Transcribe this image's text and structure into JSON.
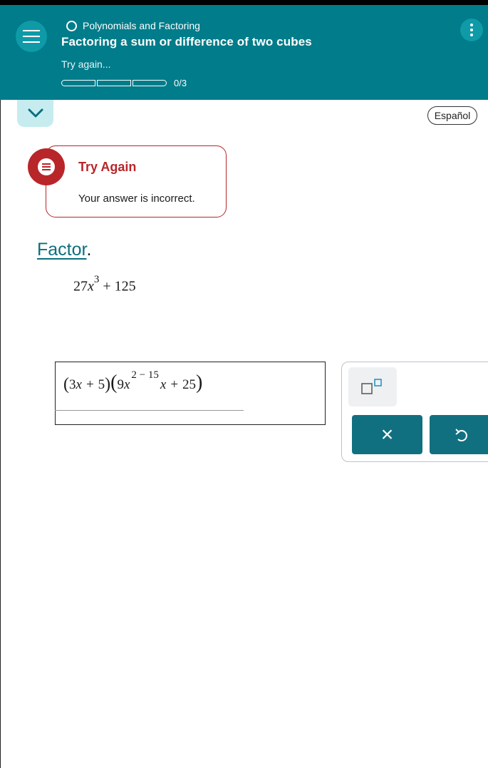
{
  "header": {
    "topic": "Polynomials and Factoring",
    "lesson_title": "Factoring a sum or difference of two cubes",
    "status": "Try again...",
    "progress": {
      "done": 0,
      "total": 3,
      "label": "0/3"
    },
    "menu_icon": "hamburger-icon",
    "more_icon": "kebab-icon"
  },
  "language_button": "Español",
  "collapse_icon": "chevron-down-icon",
  "feedback": {
    "title": "Try Again",
    "message": "Your answer is incorrect.",
    "icon": "feedback-chat-icon"
  },
  "question": {
    "instruction_link": "Factor",
    "instruction_end": ".",
    "expression": {
      "coef": "27",
      "var": "x",
      "exp": "3",
      "op": "+",
      "const": "125"
    }
  },
  "answer": {
    "open1": "(",
    "t1a": "3",
    "t1v": "x",
    "t1op": "+",
    "t1c": "5",
    "close1": ")",
    "open2": "(",
    "t2a": "9",
    "t2v": "x",
    "t2exp": "2 − 15",
    "t2v2": "x",
    "t2op": "+",
    "t2c": "25",
    "close2": ")"
  },
  "keypad": {
    "exponent_key_icon": "exponent-box-icon",
    "clear_label": "×",
    "undo_icon": "undo-icon"
  },
  "colors": {
    "header_bg": "#007c8a",
    "accent": "#11707f",
    "error": "#b8262a",
    "chevron_bg": "#c6ecf0"
  }
}
